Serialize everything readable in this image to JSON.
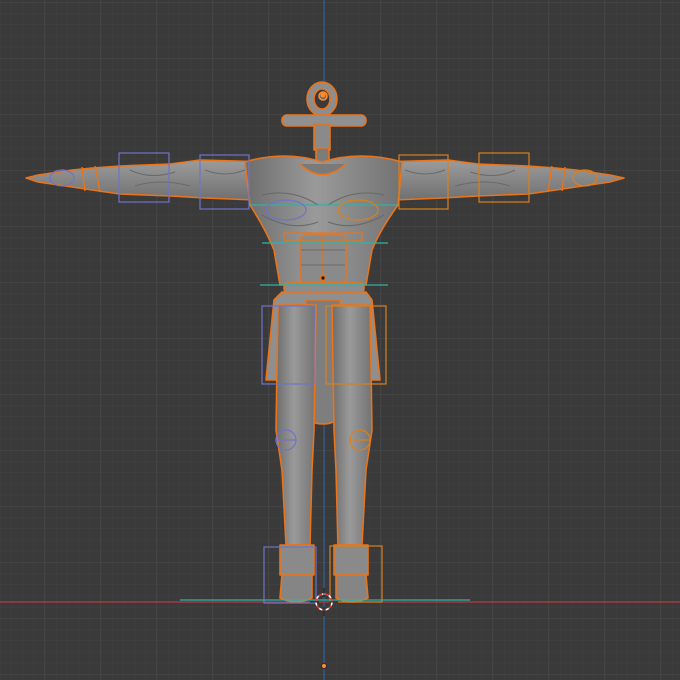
{
  "viewport": {
    "mode": "front-orthographic",
    "grid_visible": true,
    "x_axis_visible": true,
    "z_axis_visible": true
  },
  "colors": {
    "background": "#3a3a3a",
    "grid_minor": "#434343",
    "grid_major": "#4f4f4f",
    "x_axis": "#b33a48",
    "z_axis": "#2c5f9e",
    "mesh_fill": "#8a8a8a",
    "mesh_shade": "#6e6e6e",
    "selection_outline": "#e8741c",
    "active_outline": "#ff8a2a",
    "bone_blue": "#6f73c8",
    "bone_orange": "#d9801e",
    "ik_cyan": "#2fb3a6",
    "cursor_red": "#e23a3a",
    "origin_dot": "#ff8a2a"
  },
  "scene": {
    "object": "character-mesh",
    "pose": "T-pose",
    "armature_overlay": true,
    "prop": "ankh-headpiece"
  }
}
